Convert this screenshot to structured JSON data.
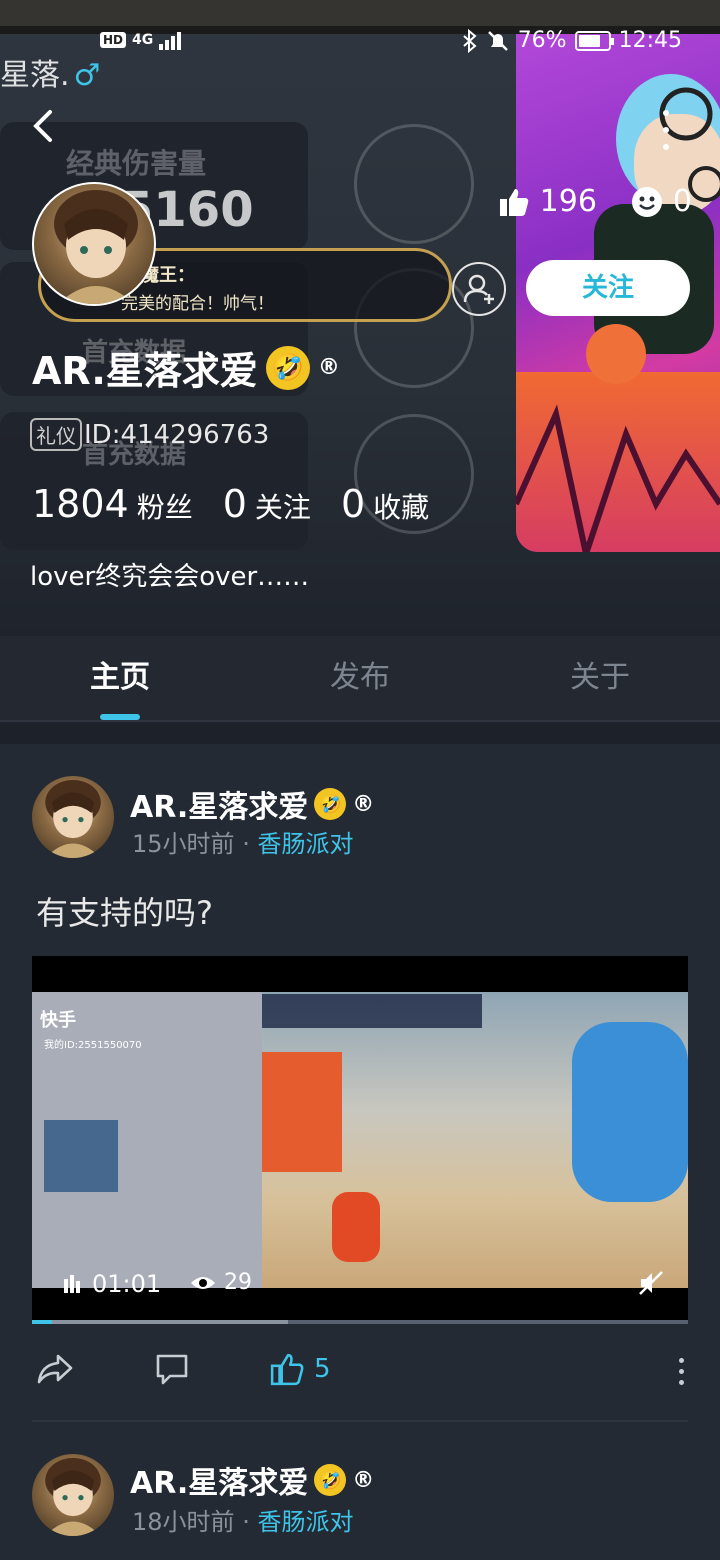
{
  "status_bar": {
    "hd": "HD",
    "network": "4G",
    "battery_percent": "76%",
    "battery_level": 0.76,
    "time": "12:45"
  },
  "background_text": {
    "top_name": "星落.",
    "male_symbol": "♂",
    "panel1_title": "经典伤害量",
    "panel1_value": "5160",
    "panel2_title": "首充数据",
    "panel3_title": "首充数据"
  },
  "profile": {
    "banner_line1": "魔王：",
    "banner_line2": "完美的配合！帅气！",
    "username": "AR.星落求爱",
    "emoji": "🤣",
    "registered": "®",
    "id_badge": "礼仪",
    "id_text": "ID:414296763",
    "fans_count": "1804",
    "fans_label": "粉丝",
    "follow_count": "0",
    "follow_label": "关注",
    "collect_count": "0",
    "collect_label": "收藏",
    "bio": "lover终究会会over……",
    "likes": "196",
    "smiles": "0",
    "follow_button": "关注"
  },
  "tabs": [
    {
      "label": "主页",
      "active": true
    },
    {
      "label": "发布",
      "active": false
    },
    {
      "label": "关于",
      "active": false
    }
  ],
  "posts": [
    {
      "author": "AR.星落求爱",
      "emoji": "🤣",
      "registered": "®",
      "time": "15小时前",
      "sep": "·",
      "game": "香肠派对",
      "text": "有支持的吗?",
      "video": {
        "logo": "快手",
        "logo_id": "我的ID:2551550070",
        "duration": "01:01",
        "views": "29",
        "progress": 0.03,
        "buffered": 0.39
      },
      "likes": "5"
    },
    {
      "author": "AR.星落求爱",
      "emoji": "🤣",
      "registered": "®",
      "time": "18小时前",
      "sep": "·",
      "game": "香肠派对"
    }
  ],
  "colors": {
    "accent": "#3ec4e8",
    "background": "#1d212a",
    "banner_border": "#c4a050"
  }
}
